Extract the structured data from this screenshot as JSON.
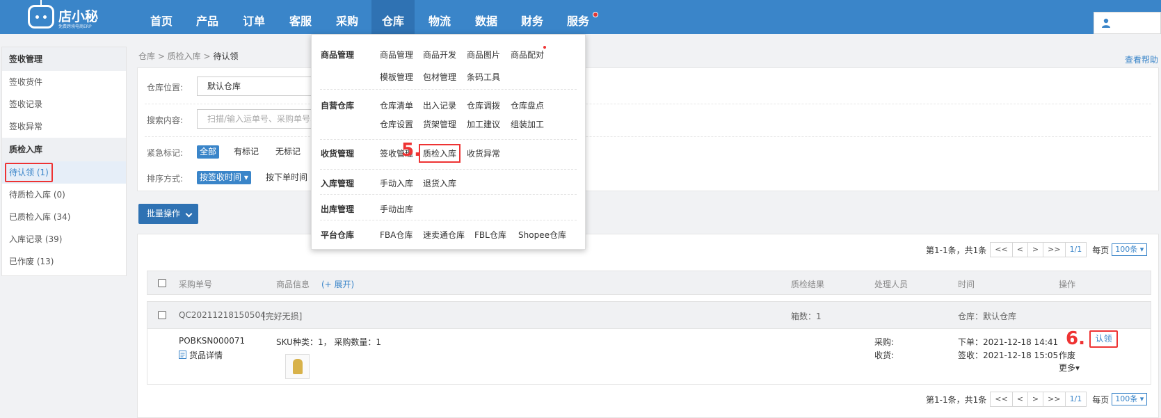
{
  "nav": {
    "brand": "店小秘",
    "slogan": "免费跨境电商ERP",
    "items": [
      "首页",
      "产品",
      "订单",
      "客服",
      "采购",
      "仓库",
      "物流",
      "数据",
      "财务",
      "服务"
    ],
    "active": "仓库"
  },
  "sidebar": {
    "groups": [
      {
        "title": "签收管理",
        "items": [
          "签收货件",
          "签收记录",
          "签收异常"
        ]
      },
      {
        "title": "质检入库",
        "items": [
          "待认领 (1)",
          "待质检入库 (0)",
          "已质检入库 (34)",
          "入库记录 (39)",
          "已作废 (13)"
        ]
      }
    ],
    "active_item": "待认领 (1)"
  },
  "breadcrumb": {
    "path": "仓库 > 质检入库 > ",
    "current": "待认领"
  },
  "help_link": "查看帮助",
  "filter": {
    "warehouse_label": "仓库位置:",
    "warehouse_value": "默认仓库",
    "search_label": "搜索内容:",
    "search_placeholder": "扫描/输入运单号、采购单号、",
    "urgent_label": "紧急标记:",
    "urgent_options": [
      "全部",
      "有标记",
      "无标记"
    ],
    "sort_label": "排序方式:",
    "sort_options": [
      "按签收时间 ▾",
      "按下单时间"
    ]
  },
  "batch_button": "批量操作",
  "pager": {
    "info": "第1-1条，共1条",
    "buttons": [
      "<<",
      "<",
      ">",
      ">>",
      "1/1"
    ],
    "per_page_label": "每页",
    "per_page_value": "100条 ▾"
  },
  "table": {
    "headers": {
      "po": "采购单号",
      "goods": "商品信息",
      "expand": "(+ 展开)",
      "result": "质检结果",
      "handler": "处理人员",
      "time": "时间",
      "op": "操作"
    },
    "group": {
      "code": "QC20211218150504",
      "tag": "[完好无损]",
      "boxes": "箱数：1",
      "warehouse": "仓库：默认仓库"
    },
    "row": {
      "po_no": "POBKSN000071",
      "detail_link": "货品详情",
      "sku_info": "SKU种类：1，  采购数量：1",
      "buyer_label": "采购:",
      "receiver_label": "收货:",
      "order_time": "下单：2021-12-18 14:41",
      "sign_time": "签收：2021-12-18 15:05",
      "actions": [
        "认领",
        "作废",
        "更多▾"
      ]
    }
  },
  "dropdown": {
    "sections": [
      {
        "category": "商品管理",
        "rows": [
          [
            "商品管理",
            "商品开发",
            "商品图片",
            "商品配对"
          ],
          [
            "模板管理",
            "包材管理",
            "条码工具"
          ]
        ]
      },
      {
        "category": "自营仓库",
        "rows": [
          [
            "仓库清单",
            "出入记录",
            "仓库调拨",
            "仓库盘点"
          ],
          [
            "仓库设置",
            "货架管理",
            "加工建议",
            "组装加工"
          ]
        ]
      },
      {
        "category": "收货管理",
        "rows": [
          [
            "签收管理",
            "质检入库",
            "收货异常"
          ]
        ]
      },
      {
        "category": "入库管理",
        "rows": [
          [
            "手动入库",
            "退货入库"
          ]
        ]
      },
      {
        "category": "出库管理",
        "rows": [
          [
            "手动出库"
          ]
        ]
      },
      {
        "category": "平台仓库",
        "rows": [
          [
            "FBA仓库",
            "速卖通仓库",
            "FBL仓库",
            "Shopee仓库"
          ]
        ]
      }
    ]
  },
  "annotations": {
    "step5": "5.",
    "step6": "6."
  },
  "colors": {
    "nav": "#3a85c9",
    "accent": "#3a85c9",
    "highlight": "#e33333"
  }
}
